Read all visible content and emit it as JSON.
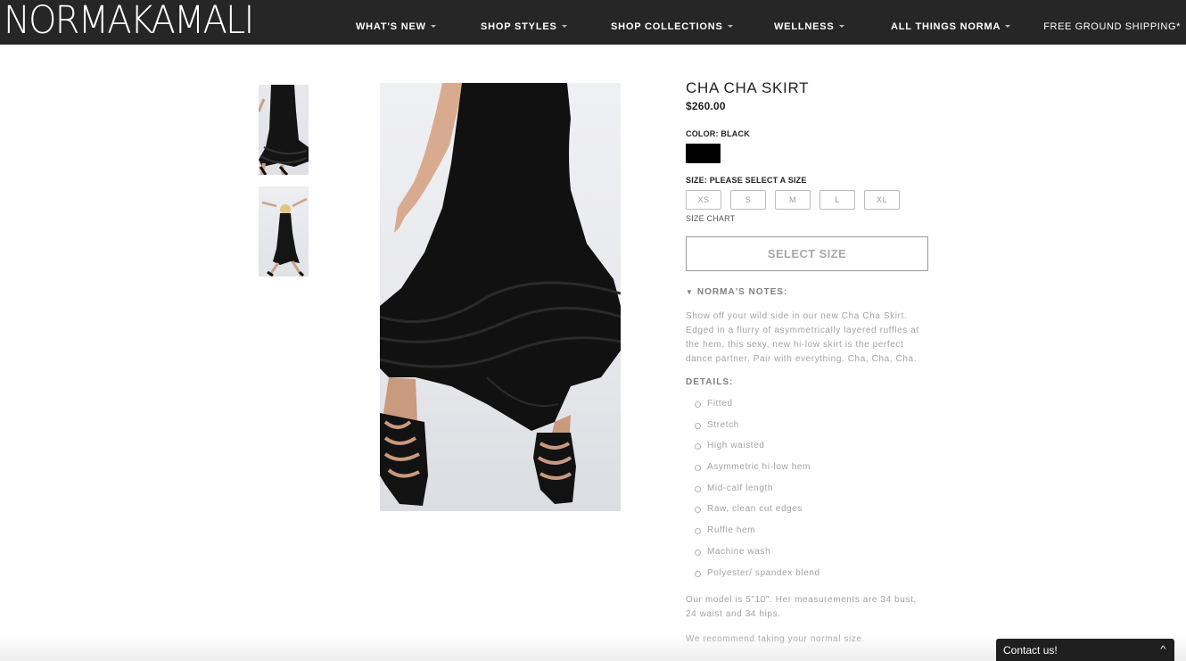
{
  "header": {
    "logo": "NORMAKAMALI",
    "nav": [
      {
        "label": "WHAT'S NEW"
      },
      {
        "label": "SHOP STYLES"
      },
      {
        "label": "SHOP COLLECTIONS"
      },
      {
        "label": "WELLNESS"
      },
      {
        "label": "ALL THINGS NORMA"
      }
    ],
    "shipping": "FREE GROUND SHIPPING*"
  },
  "product": {
    "title": "CHA CHA SKIRT",
    "price": "$260.00",
    "color_label": "COLOR: BLACK",
    "swatch_color": "#000000",
    "size_label": "SIZE: PLEASE SELECT A SIZE",
    "sizes": [
      "XS",
      "S",
      "M",
      "L",
      "XL"
    ],
    "size_chart": "SIZE CHART",
    "select_button": "SELECT SIZE",
    "notes_heading": "NORMA'S NOTES:",
    "notes_toggle_icon": "triangle-down-icon",
    "notes_text": "Show off your wild side in our new Cha Cha Skirt. Edged in a flurry of asymmetrically layered ruffles at the hem, this sexy, new hi-low skirt is the perfect dance partner. Pair with everything. Cha, Cha, Cha.",
    "details_heading": "DETAILS:",
    "details": [
      "Fitted",
      "Stretch",
      "High waisted",
      "Asymmetric hi-low hem",
      "Mid-calf length",
      "Raw, clean cut edges",
      "Ruffle hem",
      "Machine wash",
      "Polyester/ spandex blend"
    ],
    "model_text": "Our model is 5\"10\". Her measurements are 34 bust, 24 waist and 34 hips.",
    "recommend_text": "We recommend taking your normal size."
  },
  "contact": {
    "label": "Contact us!",
    "icon": "chevron-up-icon"
  }
}
